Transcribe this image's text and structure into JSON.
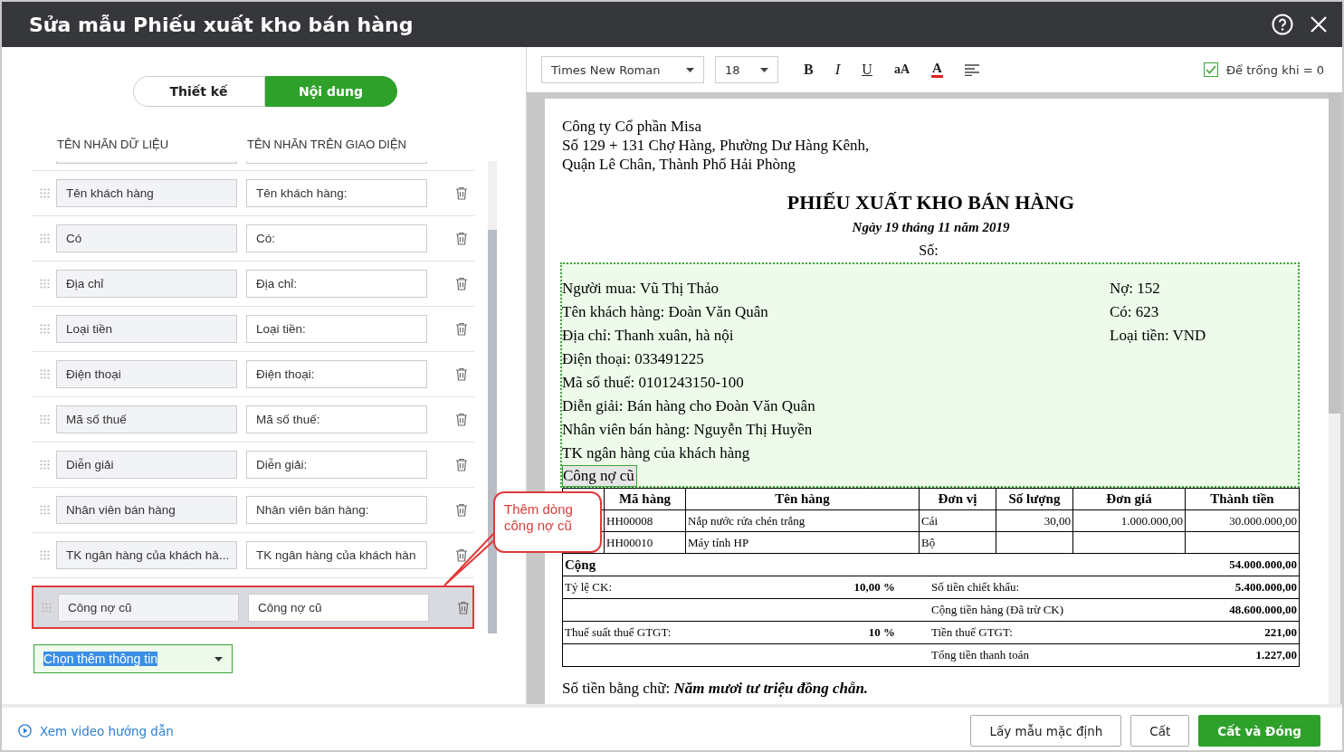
{
  "dialog": {
    "title": "Sửa mẫu Phiếu xuất kho bán hàng"
  },
  "tabs": [
    {
      "label": "Thiết kế",
      "selected": false
    },
    {
      "label": "Nội dung",
      "selected": true
    }
  ],
  "columns": [
    "TÊN NHÃN DỮ LIỆU",
    "TÊN NHÃN TRÊN GIAO DIỆN"
  ],
  "fields": [
    {
      "data_label": "Tên khách hàng",
      "display_label": "Tên khách hàng:",
      "selected": false
    },
    {
      "data_label": "Có",
      "display_label": "Có:",
      "selected": false
    },
    {
      "data_label": "Địa chỉ",
      "display_label": "Địa chỉ:",
      "selected": false
    },
    {
      "data_label": "Loại tiền",
      "display_label": "Loại tiền:",
      "selected": false
    },
    {
      "data_label": "Điện thoại",
      "display_label": "Điện thoại:",
      "selected": false
    },
    {
      "data_label": "Mã số thuế",
      "display_label": "Mã số thuế:",
      "selected": false
    },
    {
      "data_label": "Diễn giải",
      "display_label": "Diễn giải:",
      "selected": false
    },
    {
      "data_label": "Nhân viên bán hàng",
      "display_label": "Nhân viên bán hàng:",
      "selected": false
    },
    {
      "data_label": "TK ngân hàng của khách hà...",
      "display_label": "TK ngân hàng của khách hàn",
      "selected": false
    },
    {
      "data_label": "Công nợ cũ",
      "display_label": "Công nợ cũ",
      "selected": true
    }
  ],
  "add_field_dropdown": {
    "value": "Chọn thêm thông tin"
  },
  "callout": {
    "text": "Thêm dòng công nợ cũ"
  },
  "toolbar": {
    "font": "Times New Roman",
    "size": "18",
    "buttons": [
      {
        "kind": "bold",
        "label": "B"
      },
      {
        "kind": "italic",
        "label": "I"
      },
      {
        "kind": "underline",
        "label": "U"
      },
      {
        "kind": "case",
        "label": "aA"
      },
      {
        "kind": "color",
        "label": "A"
      },
      {
        "kind": "align"
      }
    ],
    "blank_if_zero": {
      "label": "Để trống khi = 0",
      "checked": true
    }
  },
  "document": {
    "company_lines": [
      "Công ty Cổ phần Misa",
      "Số 129 + 131 Chợ Hàng, Phường Dư Hàng Kênh,",
      "Quận Lê Chân, Thành Phố Hải Phòng"
    ],
    "title": "PHIẾU XUẤT KHO BÁN HÀNG",
    "date": "Ngày 19 tháng 11 năm 2019",
    "number_label": "Số:",
    "info_left": [
      {
        "text": "Người mua: Vũ Thị Thảo",
        "selected": false
      },
      {
        "text": "Tên khách hàng: Đoàn Văn Quân",
        "selected": false
      },
      {
        "text": "Địa chỉ: Thanh xuân, hà nội",
        "selected": false
      },
      {
        "text": "Điện thoại: 033491225",
        "selected": false
      },
      {
        "text": "Mã số thuế: 0101243150-100",
        "selected": false
      },
      {
        "text": "Diễn giải: Bán hàng cho Đoàn Văn Quân",
        "selected": false
      },
      {
        "text": "Nhân viên bán hàng: Nguyễn Thị Huyền",
        "selected": false
      },
      {
        "text": "TK ngân hàng của khách hàng",
        "selected": false
      },
      {
        "text": "Công nợ cũ",
        "selected": true
      }
    ],
    "info_right": [
      "Nợ: 152",
      "Có: 623",
      "Loại tiền: VND"
    ],
    "table": {
      "columns": [
        "Mã hàng",
        "Tên hàng",
        "Đơn vị",
        "Số lượng",
        "Đơn giá",
        "Thành tiền"
      ],
      "rows": [
        {
          "code": "HH00008",
          "name": "Nắp nước rửa chén trắng",
          "unit": "Cái",
          "quantity": "30,00",
          "price": "1.000.000,00",
          "amount": "30.000.000,00"
        },
        {
          "code": "HH00010",
          "name": "Máy tính HP",
          "unit": "Bộ"
        }
      ],
      "total_label": "Cộng",
      "total": "54.000.000,00",
      "summary": [
        {
          "left_label": "Tỷ lệ CK:",
          "left_value": "10,00 %",
          "right_label": "Số tiền chiết khấu:",
          "right_value": "5.400.000,00"
        },
        {
          "right_label": "Cộng tiền hàng (Đã trừ CK)",
          "right_value": "48.600.000,00"
        },
        {
          "left_label": "Thuế suất thuế GTGT:",
          "left_value": "10 %",
          "right_label": "Tiền thuế GTGT:",
          "right_value": "221,00"
        },
        {
          "right_label": "Tổng tiền thanh toán",
          "right_value": "1.227,00"
        }
      ]
    },
    "amount_in_words": {
      "label": "Số tiền bằng chữ:",
      "value": "Năm mươi tư triệu đồng chẵn."
    }
  },
  "footer": {
    "video_link": "Xem video hướng dẫn",
    "buttons": [
      {
        "label": "Lấy mẫu mặc định",
        "kind": "secondary"
      },
      {
        "label": "Cất",
        "kind": "secondary"
      },
      {
        "label": "Cất và Đóng",
        "kind": "primary"
      }
    ]
  }
}
